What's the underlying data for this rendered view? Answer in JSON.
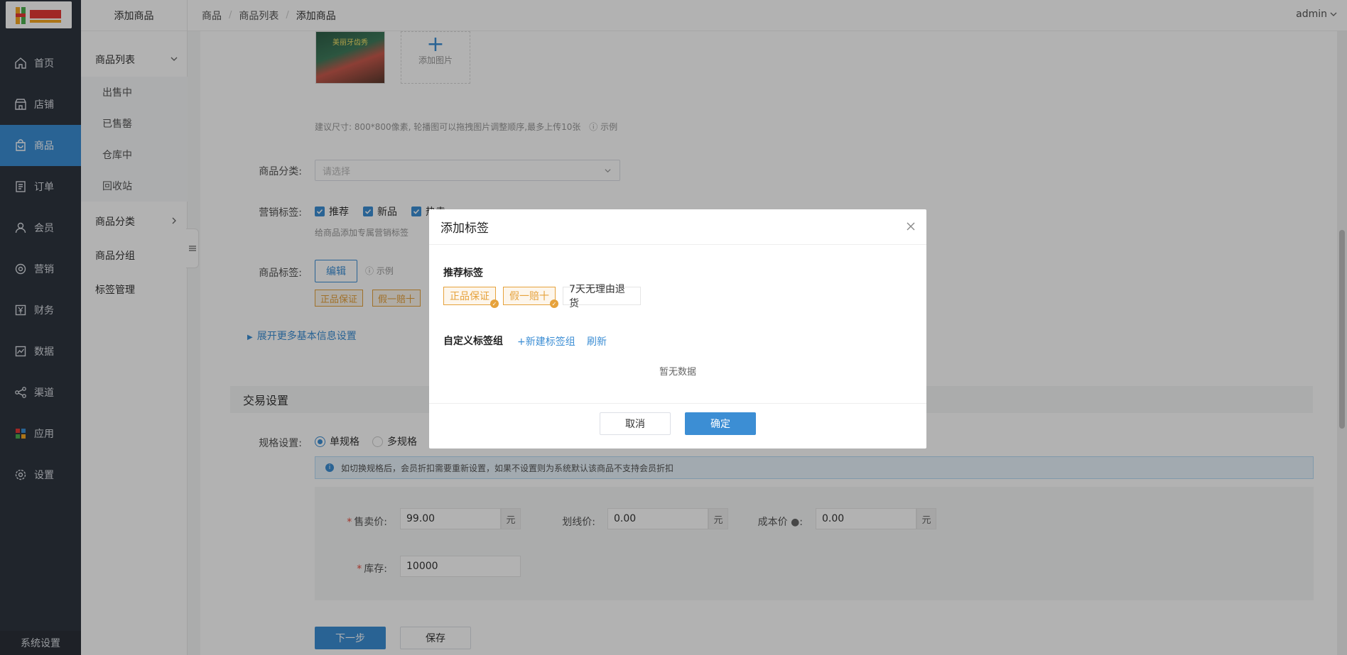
{
  "sidebar": {
    "items": [
      {
        "label": "首页",
        "icon": "home-icon"
      },
      {
        "label": "店铺",
        "icon": "store-icon"
      },
      {
        "label": "商品",
        "icon": "bag-icon",
        "active": true
      },
      {
        "label": "订单",
        "icon": "order-icon"
      },
      {
        "label": "会员",
        "icon": "user-icon"
      },
      {
        "label": "营销",
        "icon": "marketing-icon"
      },
      {
        "label": "财务",
        "icon": "yen-icon"
      },
      {
        "label": "数据",
        "icon": "chart-icon"
      },
      {
        "label": "渠道",
        "icon": "channel-icon"
      },
      {
        "label": "应用",
        "icon": "apps-icon"
      },
      {
        "label": "设置",
        "icon": "gear-icon"
      }
    ],
    "system_settings": "系统设置"
  },
  "subnav": {
    "title": "添加商品",
    "groups": [
      {
        "label": "商品列表"
      },
      {
        "label": "商品分类"
      },
      {
        "label": "商品分组"
      },
      {
        "label": "标签管理"
      }
    ],
    "children": [
      "出售中",
      "已售罄",
      "仓库中",
      "回收站"
    ]
  },
  "breadcrumb": [
    "商品",
    "商品列表",
    "添加商品"
  ],
  "user": {
    "name": "admin"
  },
  "form": {
    "image_title": "美丽牙齿秀",
    "add_image": "添加图片",
    "image_hint": "建议尺寸: 800*800像素, 轮播图可以拖拽图片调整顺序,最多上传10张",
    "example": "示例",
    "category_label": "商品分类:",
    "category_placeholder": "请选择",
    "marketing_label": "营销标签:",
    "marketing_tags": [
      "推荐",
      "新品",
      "热卖"
    ],
    "marketing_hint": "给商品添加专属营销标签",
    "tag_label": "商品标签:",
    "edit_button": "编辑",
    "tags": [
      "正品保证",
      "假一赔十"
    ],
    "expand_more": "展开更多基本信息设置",
    "trade_section": "交易设置",
    "spec_label": "规格设置:",
    "spec_single": "单规格",
    "spec_multi": "多规格",
    "spec_notice": "如切换规格后，会员折扣需要重新设置，如果不设置则为系统默认该商品不支持会员折扣",
    "sale_price_label": "售卖价:",
    "sale_price": "99.00",
    "line_price_label": "划线价:",
    "line_price": "0.00",
    "cost_price_label": "成本价",
    "cost_price": "0.00",
    "stock_label": "库存:",
    "stock": "10000",
    "unit": "元",
    "next_button": "下一步",
    "save_button": "保存"
  },
  "modal": {
    "title": "添加标签",
    "recommended_title": "推荐标签",
    "recommended_tags": [
      {
        "label": "正品保证",
        "selected": true
      },
      {
        "label": "假一赔十",
        "selected": true
      },
      {
        "label": "7天无理由退货",
        "selected": false
      }
    ],
    "custom_title": "自定义标签组",
    "new_group": "+新建标签组",
    "refresh": "刷新",
    "empty": "暂无数据",
    "cancel": "取消",
    "confirm": "确定"
  },
  "colors": {
    "primary": "#3c8ed4",
    "sidebar_bg": "#2f3540",
    "tag_orange": "#e6a23c"
  }
}
